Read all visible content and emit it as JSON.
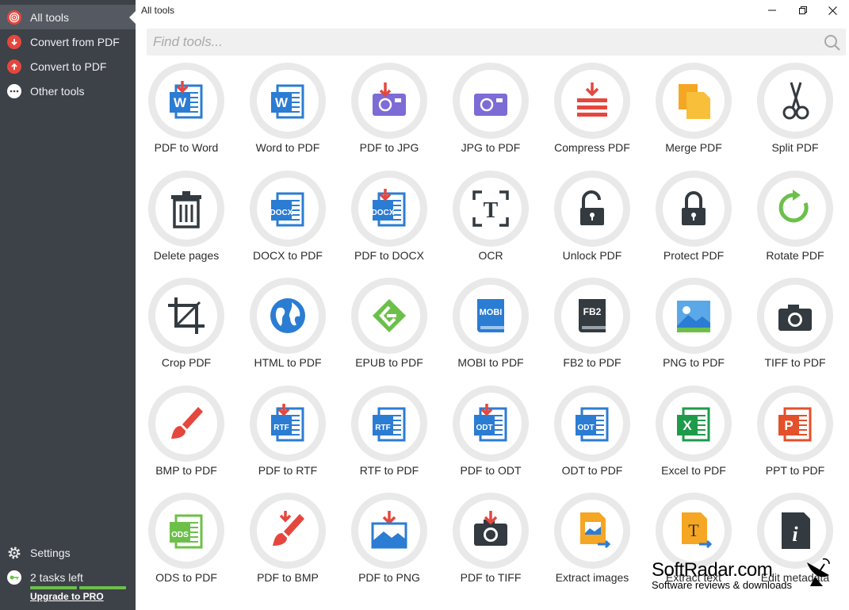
{
  "window": {
    "title": "All tools"
  },
  "sidebar": {
    "items": [
      {
        "label": "All tools",
        "icon": "target-icon",
        "active": true
      },
      {
        "label": "Convert from PDF",
        "icon": "arrow-down-icon"
      },
      {
        "label": "Convert to PDF",
        "icon": "arrow-up-icon"
      },
      {
        "label": "Other tools",
        "icon": "more-dots-icon"
      }
    ],
    "settings_label": "Settings",
    "tasks_label": "2 tasks left",
    "upgrade_label": "Upgrade to PRO",
    "tasks_progress": {
      "used": 2,
      "total": 2
    }
  },
  "search": {
    "placeholder": "Find tools..."
  },
  "tools": [
    {
      "label": "PDF to Word",
      "icon": "word-doc-icon"
    },
    {
      "label": "Word to PDF",
      "icon": "word-doc-icon"
    },
    {
      "label": "PDF to JPG",
      "icon": "image-icon"
    },
    {
      "label": "JPG to PDF",
      "icon": "image-icon"
    },
    {
      "label": "Compress PDF",
      "icon": "compress-icon"
    },
    {
      "label": "Merge PDF",
      "icon": "merge-icon"
    },
    {
      "label": "Split PDF",
      "icon": "scissors-icon"
    },
    {
      "label": "Delete pages",
      "icon": "trash-icon"
    },
    {
      "label": "DOCX to PDF",
      "icon": "docx-icon"
    },
    {
      "label": "PDF to DOCX",
      "icon": "docx-icon"
    },
    {
      "label": "OCR",
      "icon": "ocr-icon"
    },
    {
      "label": "Unlock PDF",
      "icon": "unlock-icon"
    },
    {
      "label": "Protect PDF",
      "icon": "lock-icon"
    },
    {
      "label": "Rotate PDF",
      "icon": "rotate-icon"
    },
    {
      "label": "Crop PDF",
      "icon": "crop-icon"
    },
    {
      "label": "HTML to PDF",
      "icon": "globe-icon"
    },
    {
      "label": "EPUB to PDF",
      "icon": "epub-icon"
    },
    {
      "label": "MOBI to PDF",
      "icon": "mobi-icon"
    },
    {
      "label": "FB2 to PDF",
      "icon": "fb2-icon"
    },
    {
      "label": "PNG to PDF",
      "icon": "picture-icon"
    },
    {
      "label": "TIFF to PDF",
      "icon": "camera-icon"
    },
    {
      "label": "BMP to PDF",
      "icon": "brush-icon"
    },
    {
      "label": "PDF to RTF",
      "icon": "rtf-icon"
    },
    {
      "label": "RTF to PDF",
      "icon": "rtf-icon"
    },
    {
      "label": "PDF to ODT",
      "icon": "odt-icon"
    },
    {
      "label": "ODT to PDF",
      "icon": "odt-icon"
    },
    {
      "label": "Excel to PDF",
      "icon": "excel-icon"
    },
    {
      "label": "PPT to PDF",
      "icon": "powerpoint-icon"
    },
    {
      "label": "ODS to PDF",
      "icon": "ods-icon"
    },
    {
      "label": "PDF to BMP",
      "icon": "brush-icon"
    },
    {
      "label": "PDF to PNG",
      "icon": "picture-icon"
    },
    {
      "label": "PDF to TIFF",
      "icon": "camera-icon"
    },
    {
      "label": "Extract images",
      "icon": "extract-images-icon"
    },
    {
      "label": "Extract text",
      "icon": "extract-text-icon"
    },
    {
      "label": "Edit metadata",
      "icon": "info-doc-icon"
    }
  ],
  "watermark": {
    "title": "SoftRadar.com",
    "subtitle": "Software reviews & downloads"
  },
  "colors": {
    "sidebar_bg": "#3d4148",
    "sidebar_active": "#555a62",
    "word_blue": "#2b7cd3",
    "red": "#e5473e",
    "purple": "#7d6bd6",
    "green": "#6cc04a",
    "orange": "#f5a623"
  }
}
